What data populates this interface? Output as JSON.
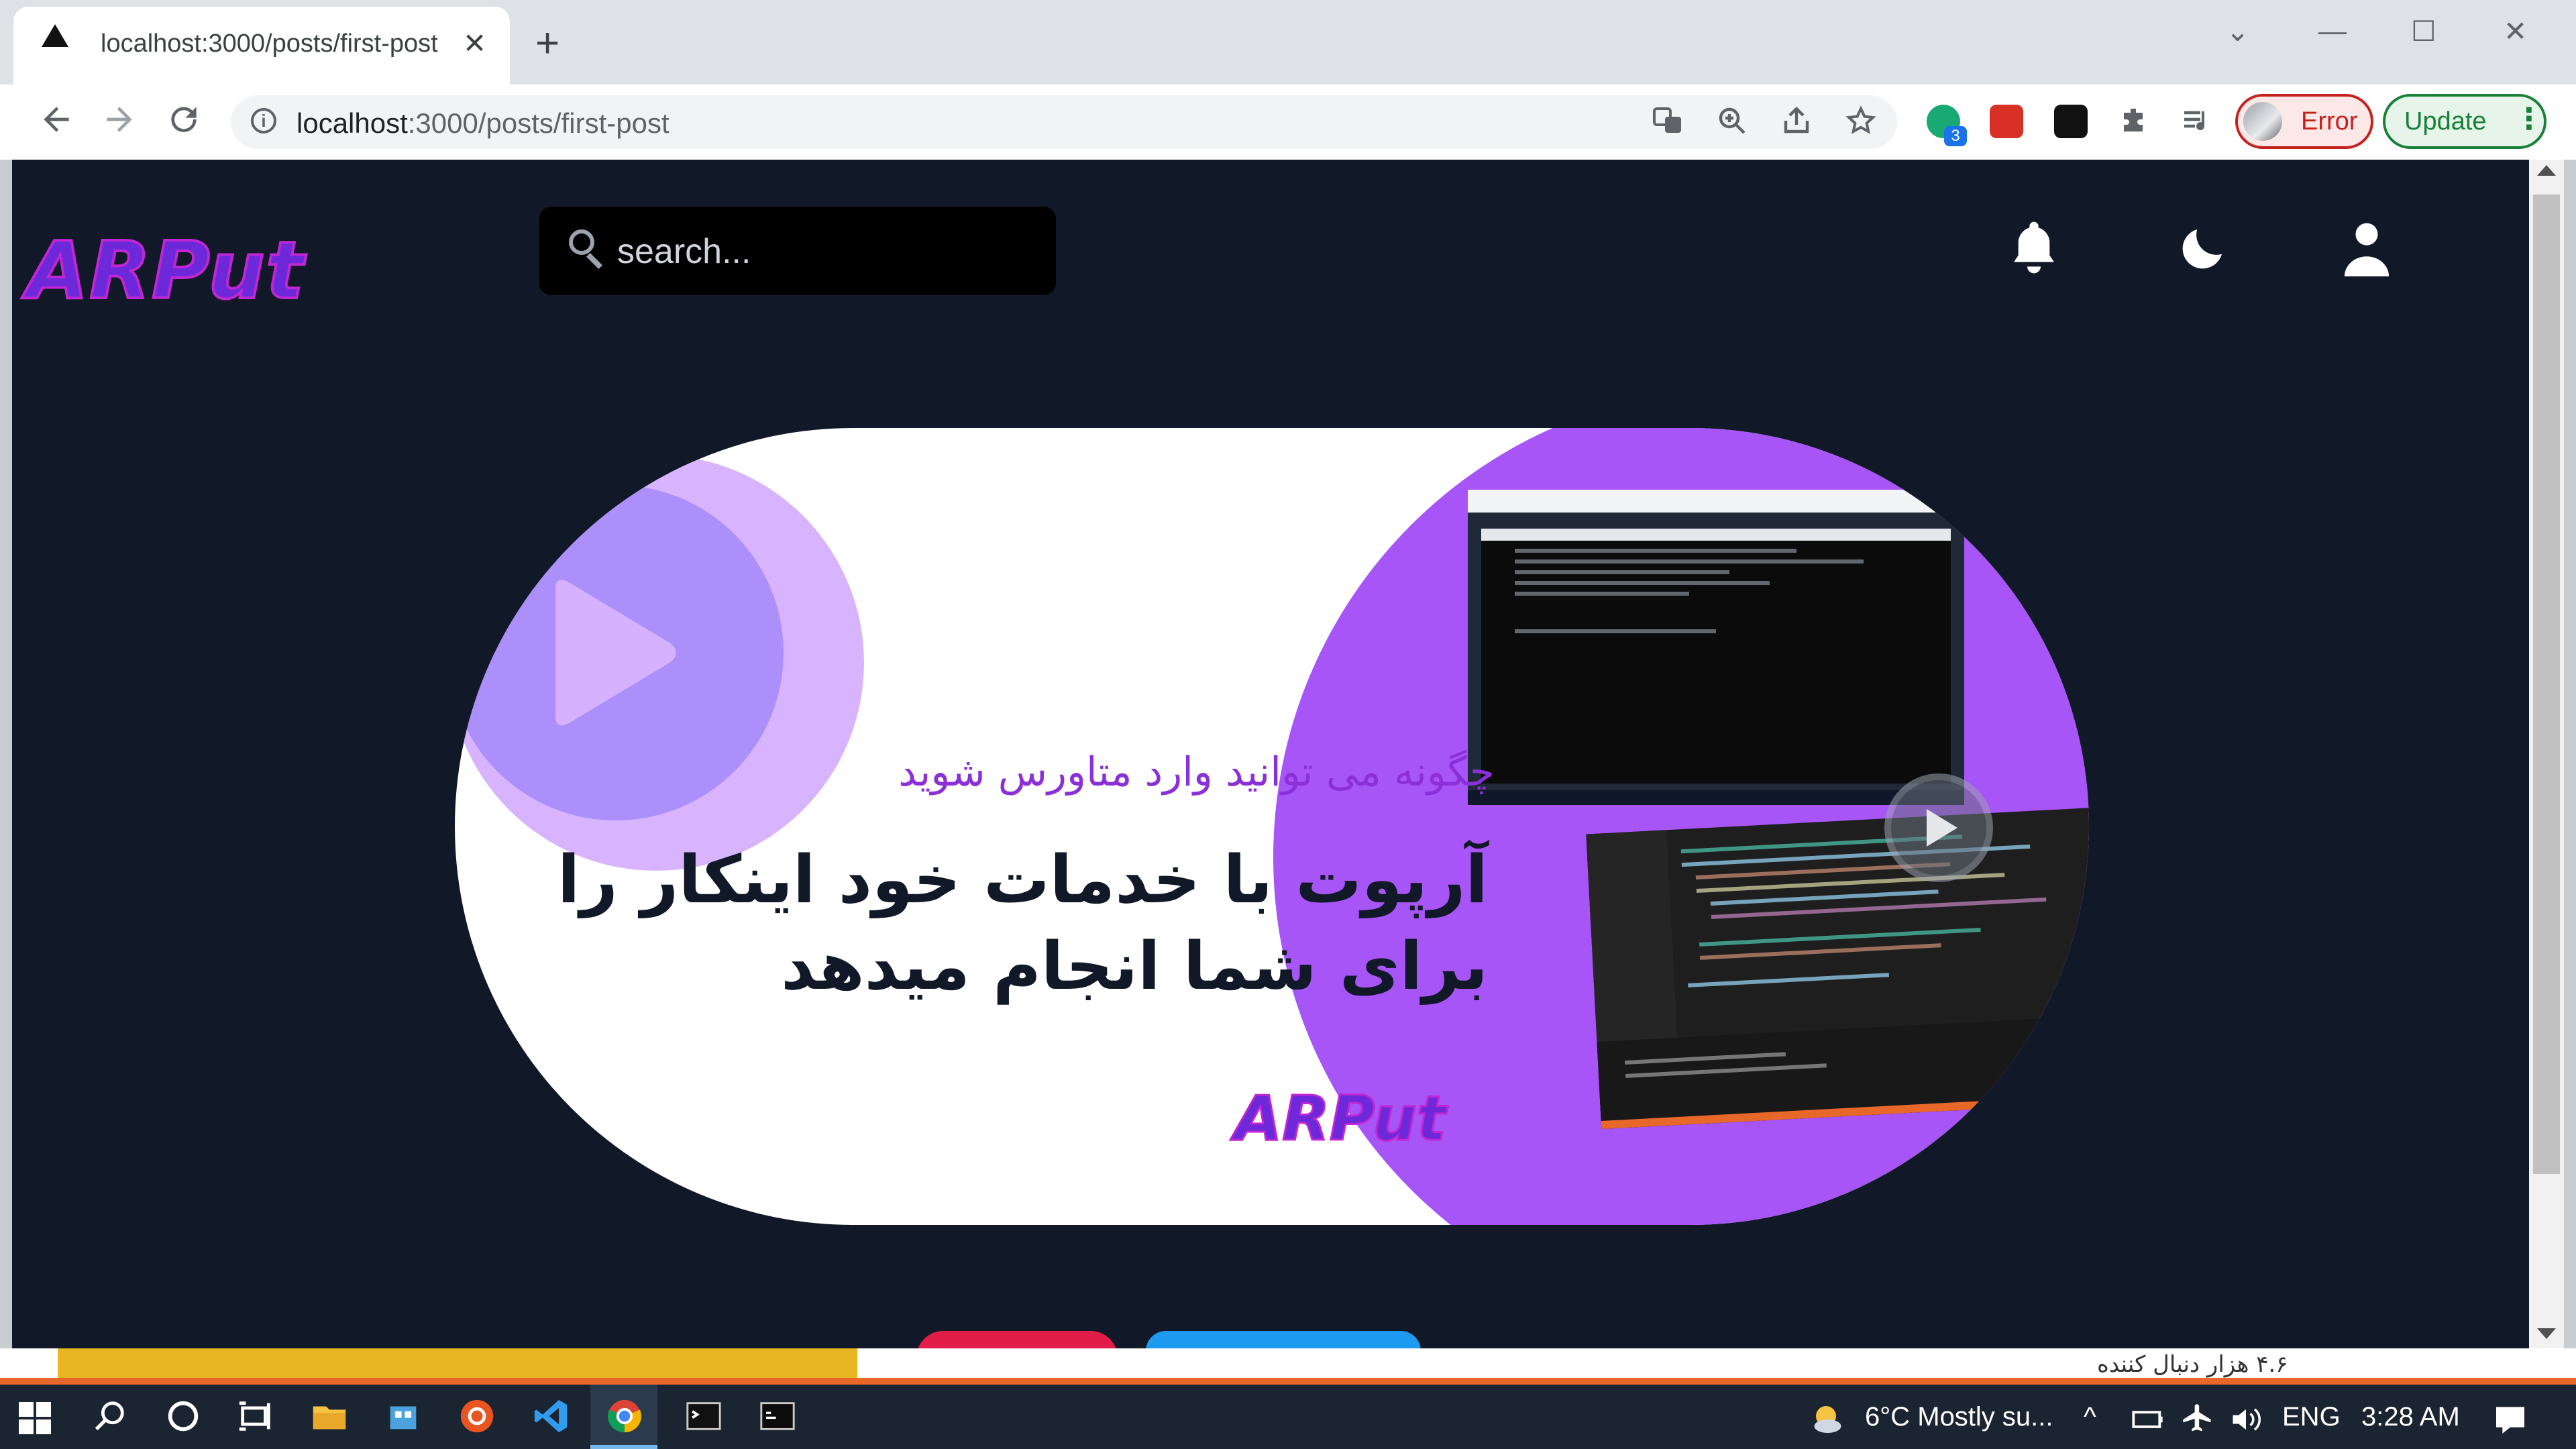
{
  "browser": {
    "tab": {
      "title": "localhost:3000/posts/first-post",
      "close_label": "✕"
    },
    "new_tab_label": "+",
    "window_controls": {
      "minimize": "—",
      "maximize": "☐",
      "close": "✕",
      "tab_search": "⌄"
    },
    "address": {
      "host": "localhost",
      "rest": ":3000/posts/first-post"
    },
    "extension_badge": "3",
    "profile_label": "Error",
    "update_label": "Update"
  },
  "page": {
    "logo": "ARPut",
    "search": {
      "placeholder": "search..."
    },
    "banner": {
      "subtitle": "چگونه می توانید وارد متاورس شوید",
      "headline_line1": "آرپوت با خدمات خود اینکار را",
      "headline_line2": "برای شما انجام میدهد",
      "logo": "ARPut"
    }
  },
  "behind_window": {
    "follower_text": "۴.۶ هزار دنبال کننده"
  },
  "taskbar": {
    "weather": "6°C  Mostly su...",
    "language": "ENG",
    "time": "3:28 AM"
  },
  "colors": {
    "page_bg": "#111827",
    "brand_purple": "#6d28d9",
    "accent_violet": "#a855f7",
    "error_red": "#c5221f",
    "update_green": "#188038"
  },
  "icons": [
    "back-icon",
    "forward-icon",
    "reload-icon",
    "info-icon",
    "translate-icon",
    "zoom-icon",
    "share-icon",
    "star-icon",
    "puzzle-icon",
    "media-icon",
    "search-icon",
    "bell-icon",
    "moon-icon",
    "user-icon",
    "play-icon",
    "windows-start-icon"
  ]
}
